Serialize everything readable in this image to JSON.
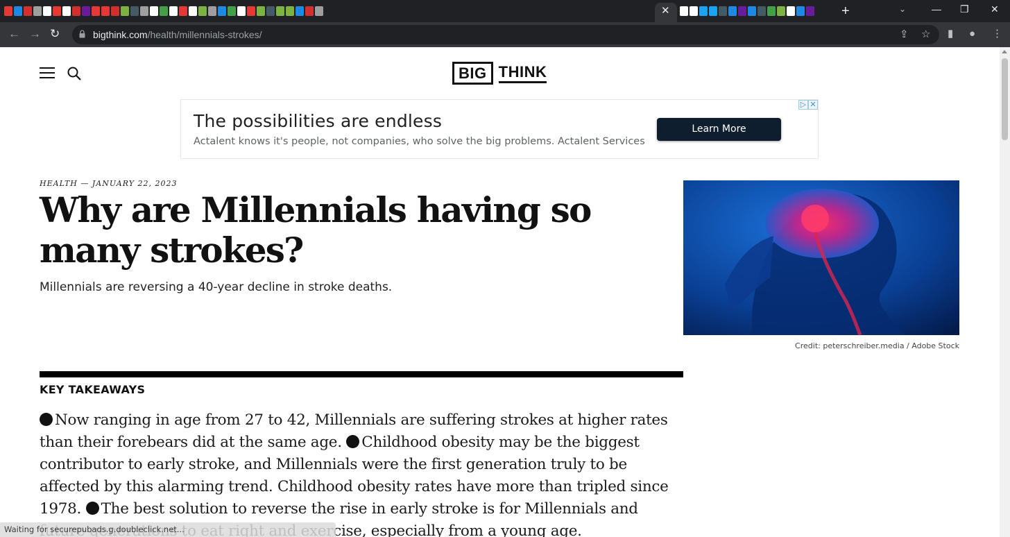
{
  "browser": {
    "url_host": "bigthink.com",
    "url_path": "/health/millennials-strokes/",
    "icons": {
      "back": "arrow-left-icon",
      "forward": "arrow-right-icon",
      "reload": "reload-icon",
      "share": "share-icon",
      "bookmark": "star-icon",
      "sidepanel": "side-panel-icon",
      "profile": "profile-icon",
      "menu": "kebab-menu-icon"
    },
    "tab_favicon_colors": [
      "#e53935",
      "#1e88e5",
      "#d32f2f",
      "#9e9e9e",
      "#ffffff",
      "#e53935",
      "#ffffff",
      "#d32f2f",
      "#6a1b9a",
      "#e53935",
      "#e53935",
      "#d32f2f",
      "#7cb342",
      "#455a64",
      "#9e9e9e",
      "#ffffff",
      "#43a047",
      "#ffffff",
      "#e53935",
      "#ffffff",
      "#7cb342",
      "#9e9e9e",
      "#1e88e5",
      "#43a047",
      "#ffffff",
      "#e53935",
      "#7cb342",
      "#455a64",
      "#7cb342",
      "#7cb342",
      "#1e88e5",
      "#d32f2f",
      "#9e9e9e"
    ],
    "tab_favicon_colors_2": [
      "#ffffff",
      "#ffffff",
      "#1da1f2",
      "#1da1f2",
      "#455a64",
      "#1e88e5",
      "#6a1b9a",
      "#1e88e5",
      "#455a64",
      "#43a047",
      "#7cb342",
      "#ffffff",
      "#1e88e5",
      "#6a1b9a"
    ]
  },
  "site": {
    "logo_left": "BIG",
    "logo_right": "THINK"
  },
  "ad": {
    "title": "The possibilities are endless",
    "subtitle": "Actalent knows it's people, not companies, who solve the big problems. Actalent Services",
    "button": "Learn More"
  },
  "article": {
    "kicker": "HEALTH — JANUARY 22, 2023",
    "headline": "Why are Millennials having so many strokes?",
    "dek": "Millennials are reversing a 40-year decline in stroke deaths.",
    "image_credit": "Credit: peterschreiber.media / Adobe Stock",
    "key_takeaways_label": "KEY TAKEAWAYS",
    "takeaways": [
      "Now ranging in age from 27 to 42, Millennials are suffering strokes at higher rates than their forebears did at the same age.",
      "Childhood obesity may be the biggest contributor to early stroke, and Millennials were the first generation truly to be affected by this alarming trend. Childhood obesity rates have more than tripled since 1978.",
      "The best solution to reverse the rise in early stroke is for Millennials and future generations to eat right and exercise, especially from a young age."
    ]
  },
  "status_bar": "Waiting for securepubads.g.doubleclick.net..."
}
